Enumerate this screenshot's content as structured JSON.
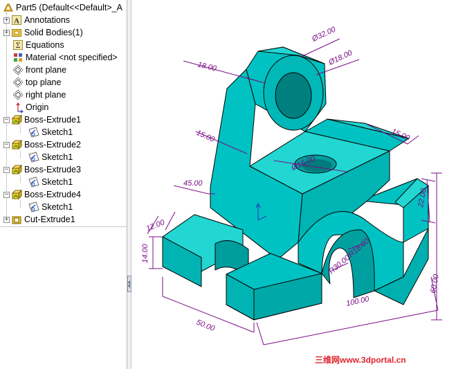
{
  "feature_tree": {
    "root": "Part5  (Default<<Default>_A",
    "items": [
      {
        "label": "Annotations",
        "icon": "annotations-icon"
      },
      {
        "label": "Solid Bodies(1)",
        "icon": "solid-bodies-folder-icon"
      },
      {
        "label": "Equations",
        "icon": "equations-icon"
      },
      {
        "label": "Material <not specified>",
        "icon": "material-icon"
      },
      {
        "label": "front plane",
        "icon": "plane-icon"
      },
      {
        "label": "top plane",
        "icon": "plane-icon"
      },
      {
        "label": "right plane",
        "icon": "plane-icon"
      },
      {
        "label": "Origin",
        "icon": "origin-icon"
      },
      {
        "label": "Boss-Extrude1",
        "icon": "boss-extrude-icon"
      },
      {
        "label": "Sketch1",
        "icon": "sketch-icon"
      },
      {
        "label": "Boss-Extrude2",
        "icon": "boss-extrude-icon"
      },
      {
        "label": "Sketch1",
        "icon": "sketch-icon"
      },
      {
        "label": "Boss-Extrude3",
        "icon": "boss-extrude-icon"
      },
      {
        "label": "Sketch1",
        "icon": "sketch-icon"
      },
      {
        "label": "Boss-Extrude4",
        "icon": "boss-extrude-icon"
      },
      {
        "label": "Sketch1",
        "icon": "sketch-icon"
      },
      {
        "label": "Cut-Extrude1",
        "icon": "cut-extrude-icon"
      }
    ]
  },
  "dimensions": {
    "d32": "Ø32.00",
    "d18_hole": "Ø18.00",
    "w18": "18.00",
    "w15_left": "15.00",
    "w15_right": "15.00",
    "h45": "45.00",
    "d16": "Ø16.00",
    "h22": "22.00",
    "t12": "12.00",
    "h14": "14.00",
    "r18": "R18.00",
    "r30": "R30.00",
    "h60": "60.00",
    "l100": "100.00",
    "w50": "50.00"
  },
  "watermark": "三维网www.3dportal.cn",
  "colors": {
    "model_face": "#00c2c2",
    "model_top": "#22d6d2",
    "model_dark": "#009d9d",
    "dimension": "#7a0d86",
    "watermark": "#e0242f"
  }
}
